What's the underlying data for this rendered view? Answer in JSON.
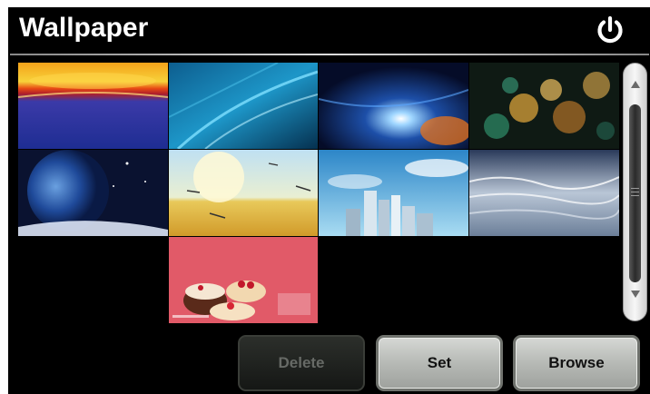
{
  "header": {
    "title": "Wallpaper",
    "power_icon": "power-icon"
  },
  "wallpapers": [
    {
      "name": "sunset-horizon"
    },
    {
      "name": "blue-light-streaks"
    },
    {
      "name": "blue-orange-glow"
    },
    {
      "name": "bokeh-lights"
    },
    {
      "name": "earth-from-space"
    },
    {
      "name": "dragonflies-wheat-field"
    },
    {
      "name": "city-skyline-blue-sky"
    },
    {
      "name": "silver-waves"
    },
    {
      "name": "cakes-calendar"
    }
  ],
  "scrollbar": {
    "up_icon": "triangle-up-icon",
    "down_icon": "triangle-down-icon"
  },
  "buttons": {
    "delete_label": "Delete",
    "set_label": "Set",
    "browse_label": "Browse"
  },
  "colors": {
    "background": "#000000",
    "title": "#ffffff",
    "button_disabled_text": "#676a66"
  }
}
